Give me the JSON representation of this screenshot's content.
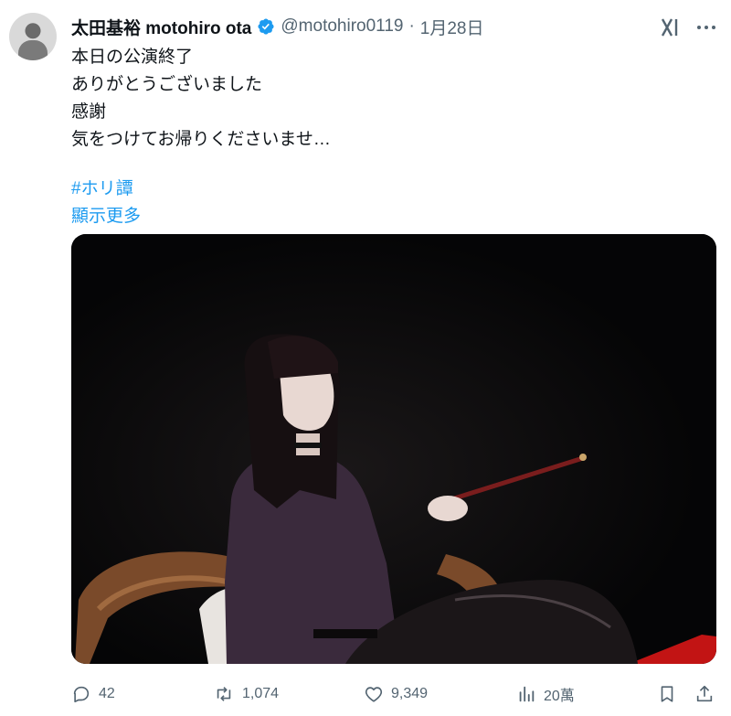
{
  "author": {
    "display_name": "太田基裕 motohiro ota",
    "handle": "@motohiro0119",
    "separator": "·",
    "date": "1月28日"
  },
  "icons": {
    "verified": "verified-badge-icon",
    "grok": "grok-icon",
    "more": "more-options-icon",
    "reply": "reply-icon",
    "repost": "repost-icon",
    "like": "like-icon",
    "views": "views-icon",
    "bookmark": "bookmark-icon",
    "share": "share-icon"
  },
  "post": {
    "lines": [
      "本日の公演終了",
      "ありがとうございました",
      "感謝",
      "気をつけてお帰りくださいませ…"
    ],
    "hashtag": "#ホリ譚",
    "show_more": "顯示更多"
  },
  "metrics": {
    "replies": "42",
    "reposts": "1,074",
    "likes": "9,349",
    "views": "20萬"
  },
  "colors": {
    "accent": "#1d9bf0",
    "text": "#0f1419",
    "muted": "#536471",
    "background": "#ffffff"
  }
}
